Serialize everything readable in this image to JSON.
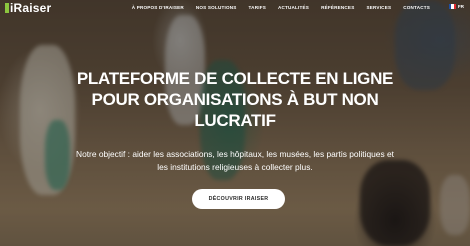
{
  "brand": {
    "logo_text": "iRaiser",
    "accent_color": "#8cc63f"
  },
  "nav": {
    "items": [
      {
        "label": "À PROPOS D'IRAISER"
      },
      {
        "label": "NOS SOLUTIONS"
      },
      {
        "label": "TARIFS"
      },
      {
        "label": "ACTUALITÉS"
      },
      {
        "label": "RÉFÉRENCES"
      },
      {
        "label": "SERVICES"
      },
      {
        "label": "CONTACTS"
      }
    ],
    "language": {
      "flag": "france-flag-icon",
      "label": "FR"
    }
  },
  "hero": {
    "headline": "PLATEFORME DE COLLECTE EN LIGNE POUR ORGANISATIONS À BUT NON LUCRATIF",
    "subtitle": "Notre objectif : aider les associations, les hôpitaux, les musées, les partis politiques et les institutions religieuses à collecter plus.",
    "cta_label": "DÉCOUVRIR IRAISER"
  }
}
